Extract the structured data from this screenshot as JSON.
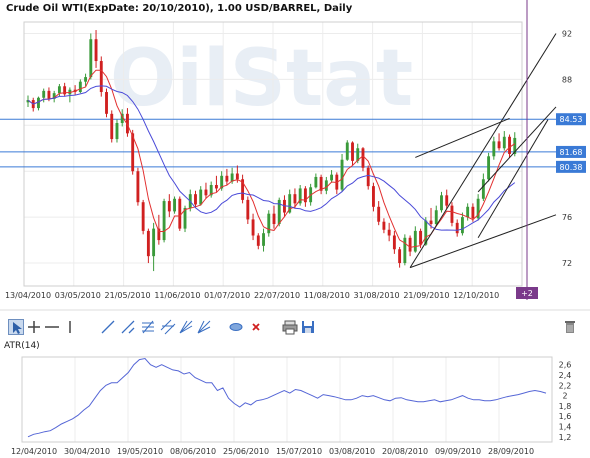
{
  "header": {
    "title": "Crude Oil WTI(ExpDate: 20/10/2010), 1.00 USD/BARREL, Daily"
  },
  "price_chart": {
    "watermark": "OilStat",
    "y_ticks": [
      "92",
      "88",
      "76",
      "72"
    ],
    "x_ticks": [
      "13/04/2010",
      "03/05/2010",
      "21/05/2010",
      "11/06/2010",
      "01/07/2010",
      "22/07/2010",
      "11/08/2010",
      "31/08/2010",
      "21/09/2010",
      "12/10/2010"
    ],
    "levels": [
      {
        "value": "84.53",
        "price": 84.53
      },
      {
        "value": "81.68",
        "price": 81.68
      },
      {
        "value": "80.38",
        "price": 80.38
      }
    ],
    "cursor_badge": "+2",
    "colors": {
      "up": "#3a9a3a",
      "down": "#d02020",
      "ma_fast": "#e23030",
      "ma_slow": "#4a4ad8",
      "level_line": "#3a7ad6",
      "badge": "#7a3a8a"
    }
  },
  "toolbar": {
    "tools": [
      {
        "name": "cursor-tool-icon",
        "title": "Cursor"
      },
      {
        "name": "crosshair-tool-icon",
        "title": "Crosshair"
      },
      {
        "name": "horizontal-line-tool-icon",
        "title": "Horizontal line"
      },
      {
        "name": "vertical-line-tool-icon",
        "title": "Vertical line"
      },
      {
        "name": "trend-line-tool-icon",
        "title": "Trend line"
      },
      {
        "name": "ray-line-tool-icon",
        "title": "Ray"
      },
      {
        "name": "fibonacci-tool-icon",
        "title": "Fibonacci"
      },
      {
        "name": "channel-tool-icon",
        "title": "Channel"
      },
      {
        "name": "fan-tool-icon",
        "title": "Fan"
      },
      {
        "name": "arc-tool-icon",
        "title": "Arc"
      },
      {
        "name": "ellipse-tool-icon",
        "title": "Ellipse"
      },
      {
        "name": "delete-tool-icon",
        "title": "Delete"
      },
      {
        "name": "print-icon",
        "title": "Print"
      },
      {
        "name": "save-icon",
        "title": "Save"
      },
      {
        "name": "trash-icon",
        "title": "Clear"
      }
    ]
  },
  "atr_panel": {
    "label": "ATR(14)",
    "y_ticks": [
      "2,6",
      "2,4",
      "2,2",
      "2",
      "1,8",
      "1,6",
      "1,4",
      "1,2"
    ],
    "x_ticks": [
      "12/04/2010",
      "30/04/2010",
      "19/05/2010",
      "08/06/2010",
      "25/06/2010",
      "15/07/2010",
      "03/08/2010",
      "20/08/2010",
      "09/09/2010",
      "28/09/2010"
    ]
  },
  "chart_data": [
    {
      "type": "candlestick",
      "title": "Crude Oil WTI(ExpDate: 20/10/2010), 1.00 USD/BARREL, Daily",
      "xlabel": "",
      "ylabel": "",
      "ylim": [
        70,
        93
      ],
      "x_start": "13/04/2010",
      "x_end": "14/10/2010",
      "ohlc": [
        [
          86.0,
          86.6,
          85.6,
          86.2
        ],
        [
          86.2,
          86.4,
          85.2,
          85.5
        ],
        [
          85.5,
          86.5,
          85.3,
          86.4
        ],
        [
          86.4,
          87.2,
          86.0,
          87.0
        ],
        [
          87.0,
          87.3,
          86.1,
          86.3
        ],
        [
          86.3,
          87.0,
          86.0,
          86.8
        ],
        [
          86.8,
          87.6,
          86.5,
          87.4
        ],
        [
          87.4,
          87.7,
          86.5,
          86.7
        ],
        [
          86.7,
          87.3,
          86.0,
          87.1
        ],
        [
          87.1,
          87.5,
          86.6,
          86.9
        ],
        [
          86.9,
          88.0,
          86.8,
          87.8
        ],
        [
          87.8,
          88.5,
          87.4,
          88.2
        ],
        [
          88.2,
          92.0,
          88.0,
          91.5
        ],
        [
          91.5,
          92.3,
          89.0,
          89.6
        ],
        [
          89.6,
          90.0,
          86.5,
          86.9
        ],
        [
          86.9,
          87.2,
          84.7,
          85.0
        ],
        [
          85.0,
          85.3,
          82.5,
          82.8
        ],
        [
          82.8,
          84.5,
          82.5,
          84.2
        ],
        [
          84.2,
          85.4,
          83.9,
          85.0
        ],
        [
          85.0,
          85.5,
          83.0,
          83.3
        ],
        [
          83.3,
          83.6,
          79.7,
          80.0
        ],
        [
          80.0,
          80.3,
          77.0,
          77.3
        ],
        [
          77.3,
          77.5,
          74.5,
          74.8
        ],
        [
          74.8,
          75.0,
          72.0,
          72.6
        ],
        [
          72.6,
          75.5,
          71.3,
          75.0
        ],
        [
          75.0,
          76.2,
          73.6,
          74.0
        ],
        [
          74.0,
          77.6,
          73.8,
          77.4
        ],
        [
          77.4,
          78.0,
          76.0,
          76.5
        ],
        [
          76.5,
          77.8,
          76.3,
          77.6
        ],
        [
          77.6,
          77.8,
          74.8,
          75.0
        ],
        [
          75.0,
          77.0,
          74.7,
          76.8
        ],
        [
          76.8,
          78.4,
          76.5,
          78.0
        ],
        [
          78.0,
          78.3,
          76.8,
          77.1
        ],
        [
          77.1,
          78.7,
          77.0,
          78.4
        ],
        [
          78.4,
          79.0,
          77.6,
          77.9
        ],
        [
          77.9,
          79.1,
          77.7,
          78.8
        ],
        [
          78.8,
          79.6,
          78.2,
          78.5
        ],
        [
          78.5,
          80.0,
          78.3,
          79.6
        ],
        [
          79.6,
          80.2,
          78.8,
          79.1
        ],
        [
          79.1,
          80.3,
          78.9,
          79.8
        ],
        [
          79.8,
          80.5,
          79.0,
          79.3
        ],
        [
          79.3,
          79.7,
          77.2,
          77.5
        ],
        [
          77.5,
          77.8,
          75.4,
          75.8
        ],
        [
          75.8,
          76.3,
          74.0,
          74.4
        ],
        [
          74.4,
          74.6,
          73.2,
          73.5
        ],
        [
          73.5,
          75.0,
          73.0,
          74.6
        ],
        [
          74.6,
          76.6,
          74.3,
          76.3
        ],
        [
          76.3,
          77.0,
          75.0,
          75.4
        ],
        [
          75.4,
          77.7,
          75.2,
          77.5
        ],
        [
          77.5,
          77.9,
          76.0,
          76.4
        ],
        [
          76.4,
          78.4,
          76.3,
          78.0
        ],
        [
          78.0,
          78.5,
          76.8,
          77.2
        ],
        [
          77.2,
          78.8,
          77.0,
          78.5
        ],
        [
          78.5,
          78.7,
          76.9,
          77.3
        ],
        [
          77.3,
          78.9,
          77.0,
          78.6
        ],
        [
          78.6,
          79.8,
          78.5,
          79.5
        ],
        [
          79.5,
          79.7,
          78.0,
          78.3
        ],
        [
          78.3,
          79.5,
          78.0,
          79.2
        ],
        [
          79.2,
          80.1,
          79.0,
          79.7
        ],
        [
          79.7,
          79.9,
          78.0,
          78.4
        ],
        [
          78.4,
          81.5,
          78.2,
          81.0
        ],
        [
          81.0,
          82.7,
          80.9,
          82.5
        ],
        [
          82.5,
          82.6,
          80.5,
          80.9
        ],
        [
          80.9,
          82.4,
          80.7,
          82.0
        ],
        [
          82.0,
          82.1,
          80.0,
          80.3
        ],
        [
          80.3,
          80.5,
          78.4,
          78.7
        ],
        [
          78.7,
          79.0,
          76.5,
          76.9
        ],
        [
          76.9,
          77.4,
          75.3,
          75.6
        ],
        [
          75.6,
          75.9,
          74.6,
          74.9
        ],
        [
          74.9,
          75.5,
          73.9,
          74.4
        ],
        [
          74.4,
          74.8,
          72.8,
          73.2
        ],
        [
          73.2,
          73.4,
          71.6,
          72.0
        ],
        [
          72.0,
          74.5,
          71.8,
          74.2
        ],
        [
          74.2,
          74.4,
          72.6,
          73.0
        ],
        [
          73.0,
          75.2,
          72.9,
          74.8
        ],
        [
          74.8,
          75.0,
          73.3,
          73.6
        ],
        [
          73.6,
          76.0,
          73.5,
          75.7
        ],
        [
          75.7,
          76.8,
          75.0,
          75.4
        ],
        [
          75.4,
          77.0,
          75.2,
          76.6
        ],
        [
          76.6,
          78.2,
          76.4,
          77.9
        ],
        [
          77.9,
          78.4,
          76.7,
          77.0
        ],
        [
          77.0,
          77.3,
          75.2,
          75.5
        ],
        [
          75.5,
          75.8,
          74.3,
          74.6
        ],
        [
          74.6,
          76.4,
          74.4,
          76.0
        ],
        [
          76.0,
          77.2,
          75.7,
          76.9
        ],
        [
          76.9,
          77.2,
          75.6,
          75.9
        ],
        [
          75.9,
          78.0,
          75.7,
          77.6
        ],
        [
          77.6,
          79.8,
          77.4,
          79.3
        ],
        [
          79.3,
          81.6,
          79.1,
          81.3
        ],
        [
          81.3,
          83.0,
          81.0,
          82.6
        ],
        [
          82.6,
          83.3,
          81.8,
          82.0
        ],
        [
          82.0,
          83.5,
          81.8,
          83.0
        ],
        [
          83.0,
          83.2,
          81.2,
          81.5
        ],
        [
          81.5,
          83.4,
          81.3,
          82.9
        ]
      ],
      "series": [
        {
          "name": "",
          "kind": "ma_fast"
        },
        {
          "name": "",
          "kind": "ma_slow"
        }
      ]
    },
    {
      "type": "line",
      "title": "ATR(14)",
      "xlabel": "",
      "ylabel": "",
      "ylim": [
        1.1,
        2.75
      ],
      "x_start": "12/04/2010",
      "x_end": "14/10/2010",
      "series": [
        {
          "name": "ATR(14)",
          "values": [
            1.2,
            1.25,
            1.27,
            1.3,
            1.32,
            1.38,
            1.45,
            1.5,
            1.55,
            1.62,
            1.72,
            1.8,
            1.95,
            2.1,
            2.2,
            2.25,
            2.25,
            2.35,
            2.45,
            2.6,
            2.7,
            2.72,
            2.6,
            2.55,
            2.6,
            2.55,
            2.5,
            2.48,
            2.42,
            2.45,
            2.35,
            2.3,
            2.25,
            2.25,
            2.1,
            2.15,
            1.95,
            1.85,
            1.78,
            1.86,
            1.82,
            1.9,
            1.92,
            1.95,
            2.0,
            2.05,
            2.1,
            2.05,
            2.12,
            2.1,
            2.05,
            2.0,
            1.95,
            2.02,
            2.0,
            1.98,
            1.95,
            1.92,
            1.92,
            1.95,
            2.0,
            1.98,
            2.0,
            1.96,
            1.92,
            1.9,
            1.95,
            1.96,
            1.92,
            1.9,
            1.88,
            1.88,
            1.9,
            1.92,
            1.88,
            1.9,
            1.92,
            1.96,
            2.0,
            1.95,
            1.92,
            1.92,
            1.9,
            1.9,
            1.92,
            1.95,
            1.98,
            2.0,
            2.02,
            2.05,
            2.08,
            2.1,
            2.08,
            2.05
          ]
        }
      ]
    }
  ]
}
